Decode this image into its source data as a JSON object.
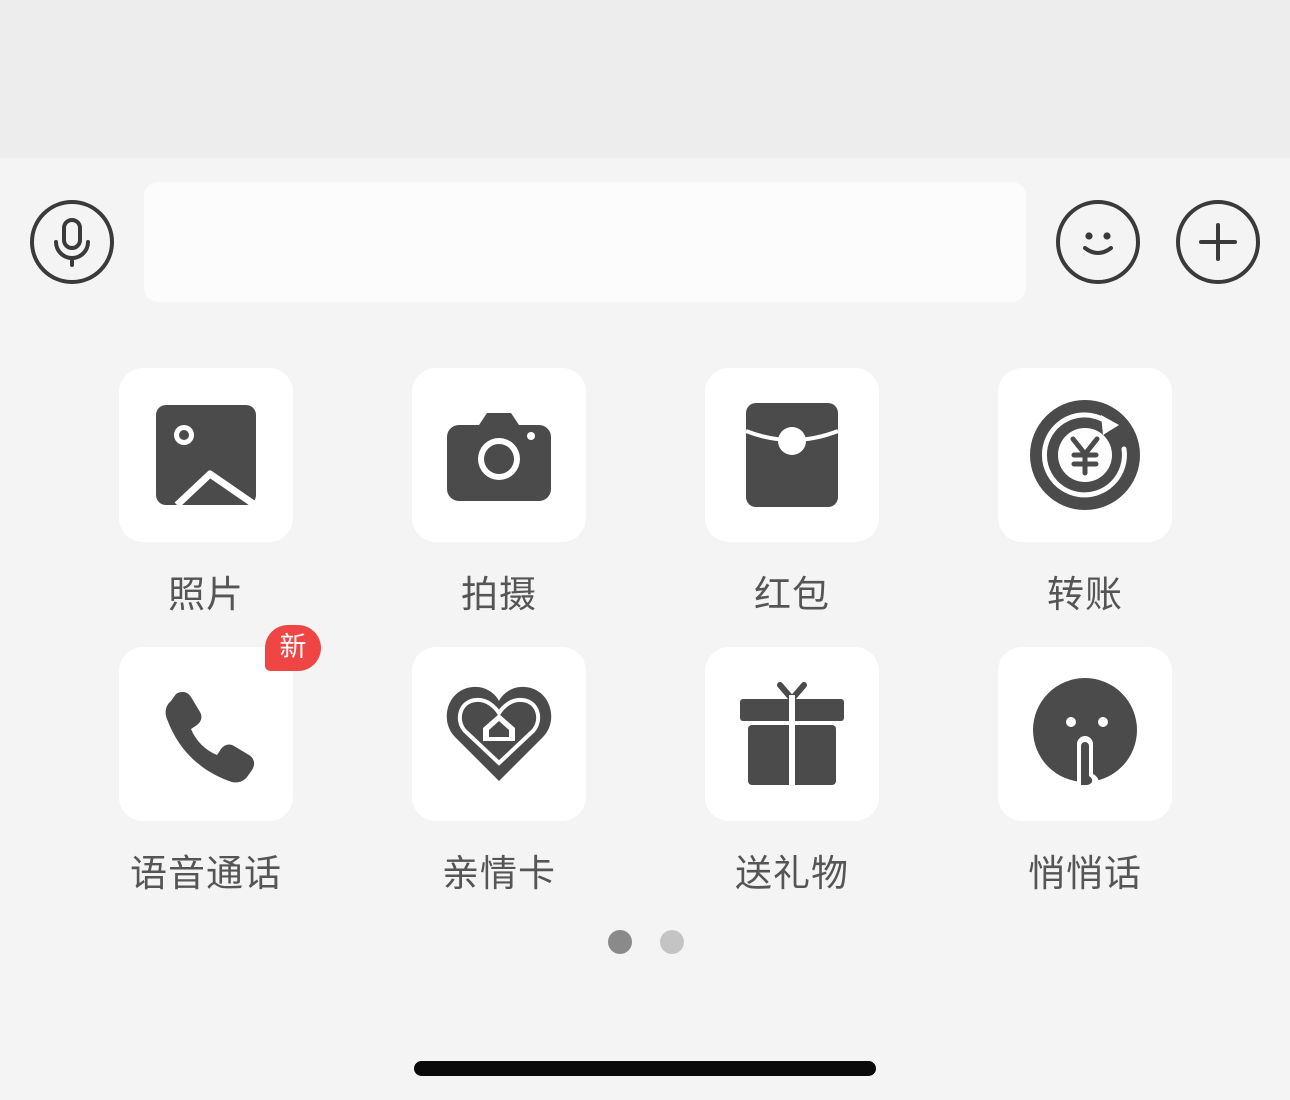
{
  "input_bar": {
    "text_value": "",
    "voice_icon": "microphone-icon",
    "emoji_icon": "smiley-face-icon",
    "more_icon": "plus-icon"
  },
  "panel": {
    "items": [
      {
        "label": "照片",
        "icon": "photo-icon"
      },
      {
        "label": "拍摄",
        "icon": "camera-icon"
      },
      {
        "label": "红包",
        "icon": "red-envelope-icon"
      },
      {
        "label": "转账",
        "icon": "transfer-yuan-icon"
      },
      {
        "label": "语音通话",
        "icon": "phone-icon",
        "badge": "新"
      },
      {
        "label": "亲情卡",
        "icon": "family-card-heart-icon"
      },
      {
        "label": "送礼物",
        "icon": "gift-icon"
      },
      {
        "label": "悄悄话",
        "icon": "shush-face-icon"
      }
    ],
    "pagination": {
      "current_page": 1,
      "total_pages": 2
    }
  },
  "colors": {
    "icon": "#4b4b4b",
    "badge": "#f04545",
    "dot_active": "#8a8a8a",
    "dot_inactive": "#c4c4c4"
  }
}
